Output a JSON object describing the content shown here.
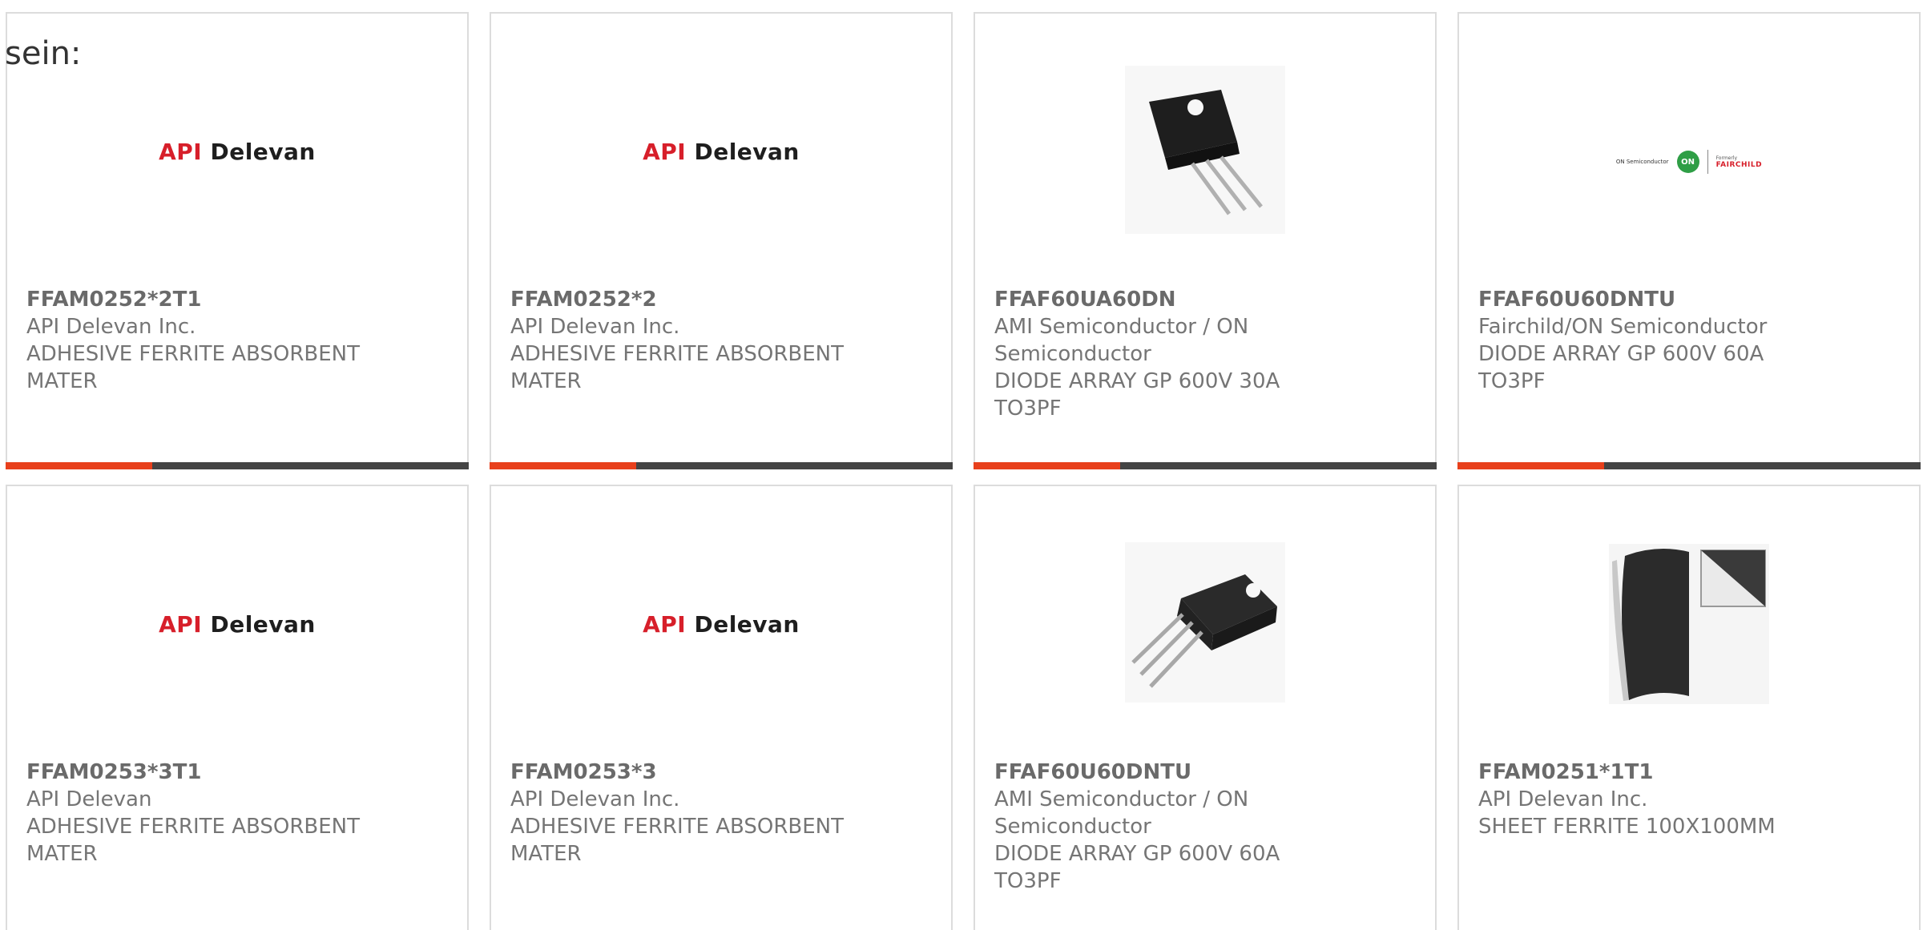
{
  "intro_text": "sein:",
  "colors": {
    "accent": "#e8401c",
    "bar": "#444444",
    "border": "#dcdcdc",
    "text": "#757575"
  },
  "products": [
    {
      "part": "FFAM0252*2T1",
      "manufacturer": "API Delevan Inc.",
      "description": "ADHESIVE FERRITE ABSORBENT MATER",
      "image": "api-delevan-logo"
    },
    {
      "part": "FFAM0252*2",
      "manufacturer": "API Delevan Inc.",
      "description": "ADHESIVE FERRITE ABSORBENT MATER",
      "image": "api-delevan-logo"
    },
    {
      "part": "FFAF60UA60DN",
      "manufacturer": "AMI Semiconductor / ON Semiconductor",
      "description": "DIODE ARRAY GP 600V 30A TO3PF",
      "image": "to3pf-package-photo"
    },
    {
      "part": "FFAF60U60DNTU",
      "manufacturer": "Fairchild/ON Semiconductor",
      "description": "DIODE ARRAY GP 600V 60A TO3PF",
      "image": "on-fairchild-logo"
    },
    {
      "part": "FFAM0253*3T1",
      "manufacturer": "API Delevan",
      "description": "ADHESIVE FERRITE ABSORBENT MATER",
      "image": "api-delevan-logo"
    },
    {
      "part": "FFAM0253*3",
      "manufacturer": "API Delevan Inc.",
      "description": "ADHESIVE FERRITE ABSORBENT MATER",
      "image": "api-delevan-logo"
    },
    {
      "part": "FFAF60U60DNTU",
      "manufacturer": "AMI Semiconductor / ON Semiconductor",
      "description": "DIODE ARRAY GP 600V 60A TO3PF",
      "image": "to220f-package-photo"
    },
    {
      "part": "FFAM0251*1T1",
      "manufacturer": "API Delevan Inc.",
      "description": "SHEET FERRITE 100X100MM",
      "image": "ferrite-sheet-photo"
    }
  ],
  "logos": {
    "api": "API",
    "delevan": "Delevan",
    "on_semi": "ON Semiconductor",
    "on_mark": "ON",
    "formerly": "Formerly",
    "fairchild": "FAIRCHILD"
  }
}
